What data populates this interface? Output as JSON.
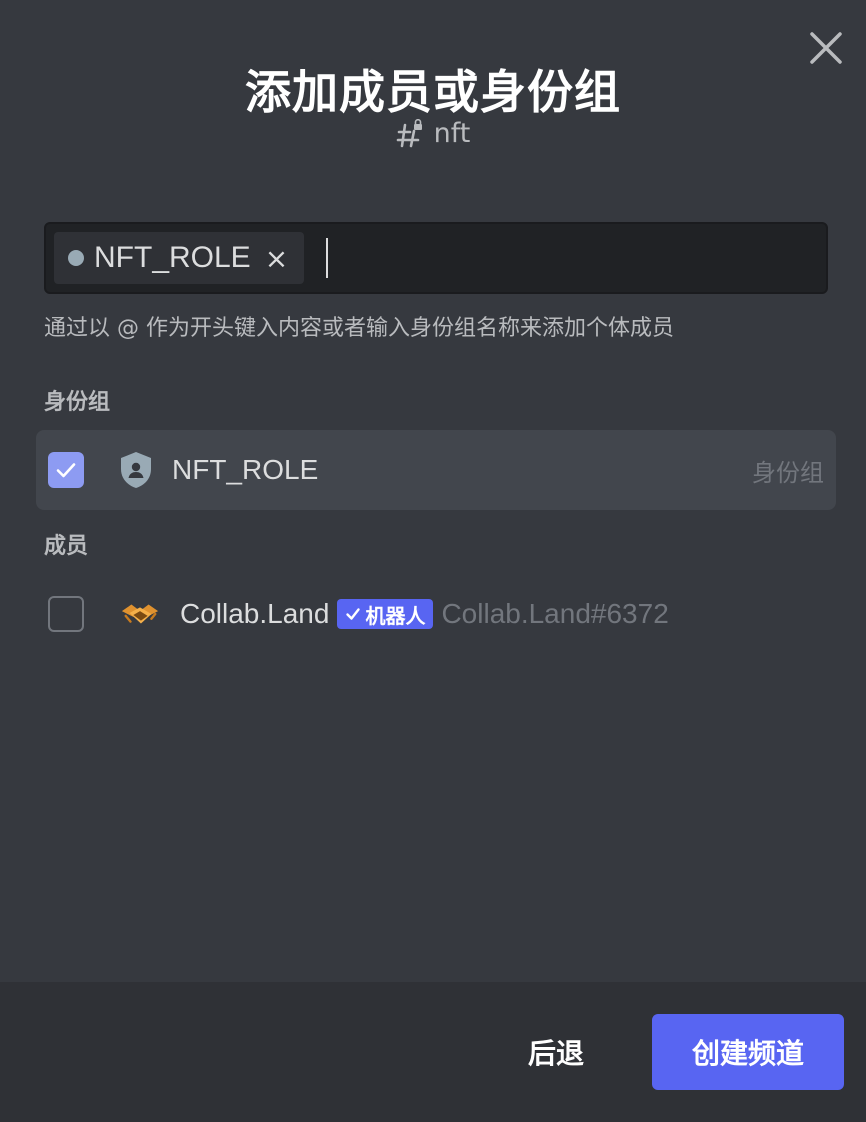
{
  "modal": {
    "title": "添加成员或身份组",
    "channel_name": "nft",
    "channel_icon": "hashtag-lock-icon",
    "close_icon": "close-icon"
  },
  "search": {
    "chips": [
      {
        "label": "NFT_ROLE",
        "dot_color": "#99aab5",
        "remove_glyph": "×"
      }
    ],
    "value": "",
    "placeholder": ""
  },
  "hint": "通过以 @ 作为开头键入内容或者输入身份组名称来添加个体成员",
  "roles_section": {
    "header": "身份组",
    "items": [
      {
        "name": "NFT_ROLE",
        "tag": "身份组",
        "checked": true,
        "icon": "role-shield-icon"
      }
    ]
  },
  "members_section": {
    "header": "成员",
    "items": [
      {
        "name": "Collab.Land",
        "badge": "机器人",
        "badge_icon": "check-icon",
        "tag": "Collab.Land#6372",
        "checked": false,
        "avatar": "collab-land-avatar"
      }
    ]
  },
  "footer": {
    "back_label": "后退",
    "create_label": "创建频道"
  },
  "colors": {
    "background": "#36393f",
    "footer_bg": "#2f3136",
    "accent": "#5865f2",
    "checkbox_checked": "#8d9bf2",
    "selected_row": "#42464d"
  }
}
